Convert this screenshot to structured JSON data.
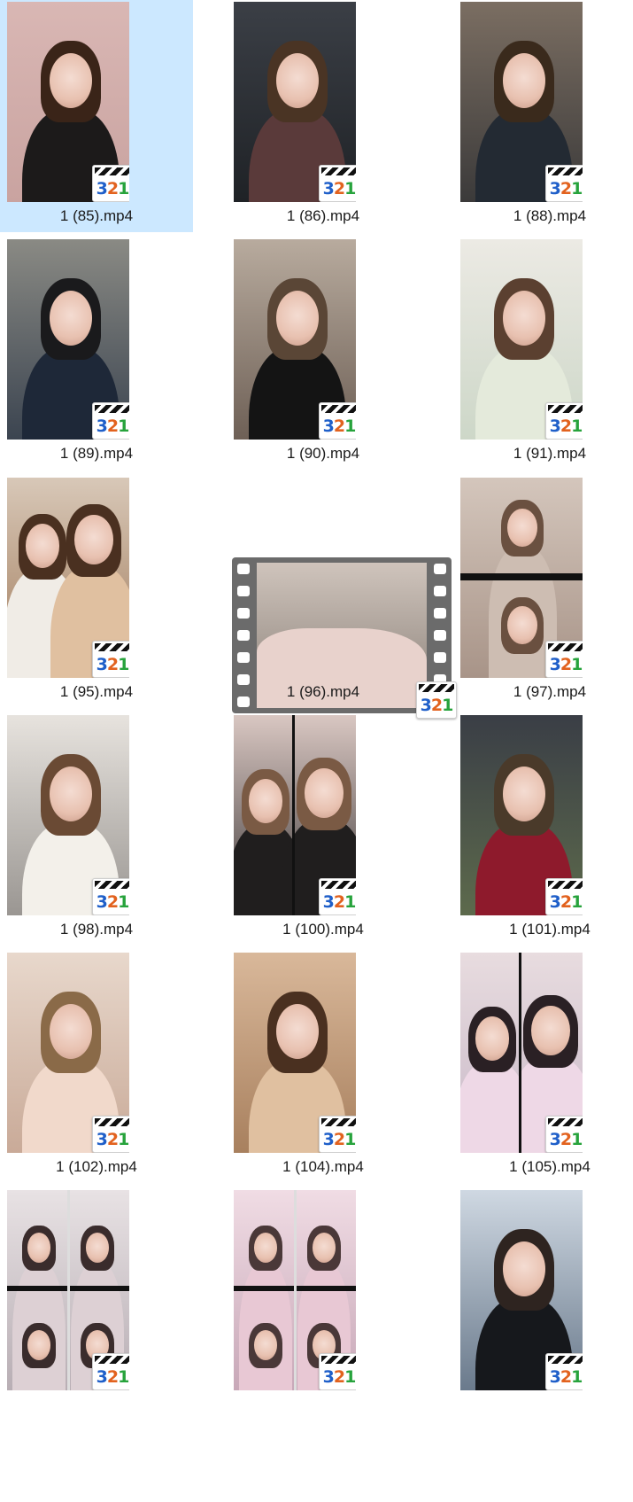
{
  "window": {
    "title": ""
  },
  "files": [
    {
      "label": "1 (85).mp4",
      "selected": true,
      "theme": "pink"
    },
    {
      "label": "1 (86).mp4",
      "selected": false,
      "theme": "car"
    },
    {
      "label": "1 (88).mp4",
      "selected": false,
      "theme": "dark"
    },
    {
      "label": "1 (89).mp4",
      "selected": false,
      "theme": "navy"
    },
    {
      "label": "1 (90).mp4",
      "selected": false,
      "theme": "black"
    },
    {
      "label": "1 (91).mp4",
      "selected": false,
      "theme": "child-room"
    },
    {
      "label": "1 (95).mp4",
      "selected": false,
      "theme": "pair"
    },
    {
      "label": "1 (96).mp4",
      "selected": false,
      "theme": "film-wide"
    },
    {
      "label": "1 (97).mp4",
      "selected": false,
      "theme": "split-sepia"
    },
    {
      "label": "1 (98).mp4",
      "selected": false,
      "theme": "sofa"
    },
    {
      "label": "1 (100).mp4",
      "selected": false,
      "theme": "double"
    },
    {
      "label": "1 (101).mp4",
      "selected": false,
      "theme": "car-red"
    },
    {
      "label": "1 (102).mp4",
      "selected": false,
      "theme": "boy"
    },
    {
      "label": "1 (104).mp4",
      "selected": false,
      "theme": "warm"
    },
    {
      "label": "1 (105).mp4",
      "selected": false,
      "theme": "split-pale"
    },
    {
      "label": "",
      "selected": false,
      "theme": "quad"
    },
    {
      "label": "",
      "selected": false,
      "theme": "quad-pink"
    },
    {
      "label": "",
      "selected": false,
      "theme": "roses"
    }
  ],
  "badge": {
    "digits": [
      "3",
      "2",
      "1"
    ],
    "icon": "media-player-classic-icon"
  }
}
